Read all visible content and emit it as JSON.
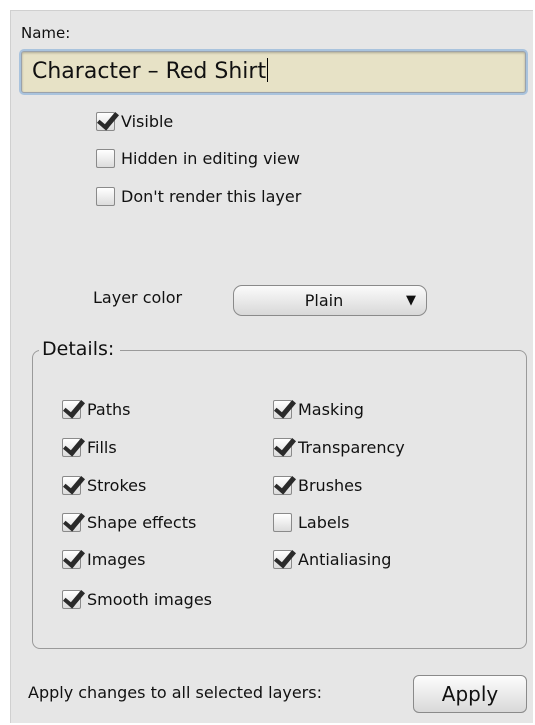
{
  "name_label": "Name:",
  "name_value": "Character – Red Shirt",
  "options": [
    {
      "label": "Visible",
      "checked": true
    },
    {
      "label": "Hidden in editing view",
      "checked": false
    },
    {
      "label": "Don't render this layer",
      "checked": false
    }
  ],
  "layer_color": {
    "label": "Layer color",
    "value": "Plain",
    "arrow": "▼"
  },
  "details": {
    "title": "Details:",
    "left": [
      {
        "label": "Paths",
        "checked": true
      },
      {
        "label": "Fills",
        "checked": true
      },
      {
        "label": "Strokes",
        "checked": true
      },
      {
        "label": "Shape effects",
        "checked": true
      },
      {
        "label": "Images",
        "checked": true
      },
      {
        "label": "Smooth images",
        "checked": true
      }
    ],
    "right": [
      {
        "label": "Masking",
        "checked": true
      },
      {
        "label": "Transparency",
        "checked": true
      },
      {
        "label": "Brushes",
        "checked": true
      },
      {
        "label": "Labels",
        "checked": false
      },
      {
        "label": "Antialiasing",
        "checked": true
      }
    ]
  },
  "footer": {
    "label": "Apply changes to all selected layers:",
    "apply_label": "Apply"
  }
}
